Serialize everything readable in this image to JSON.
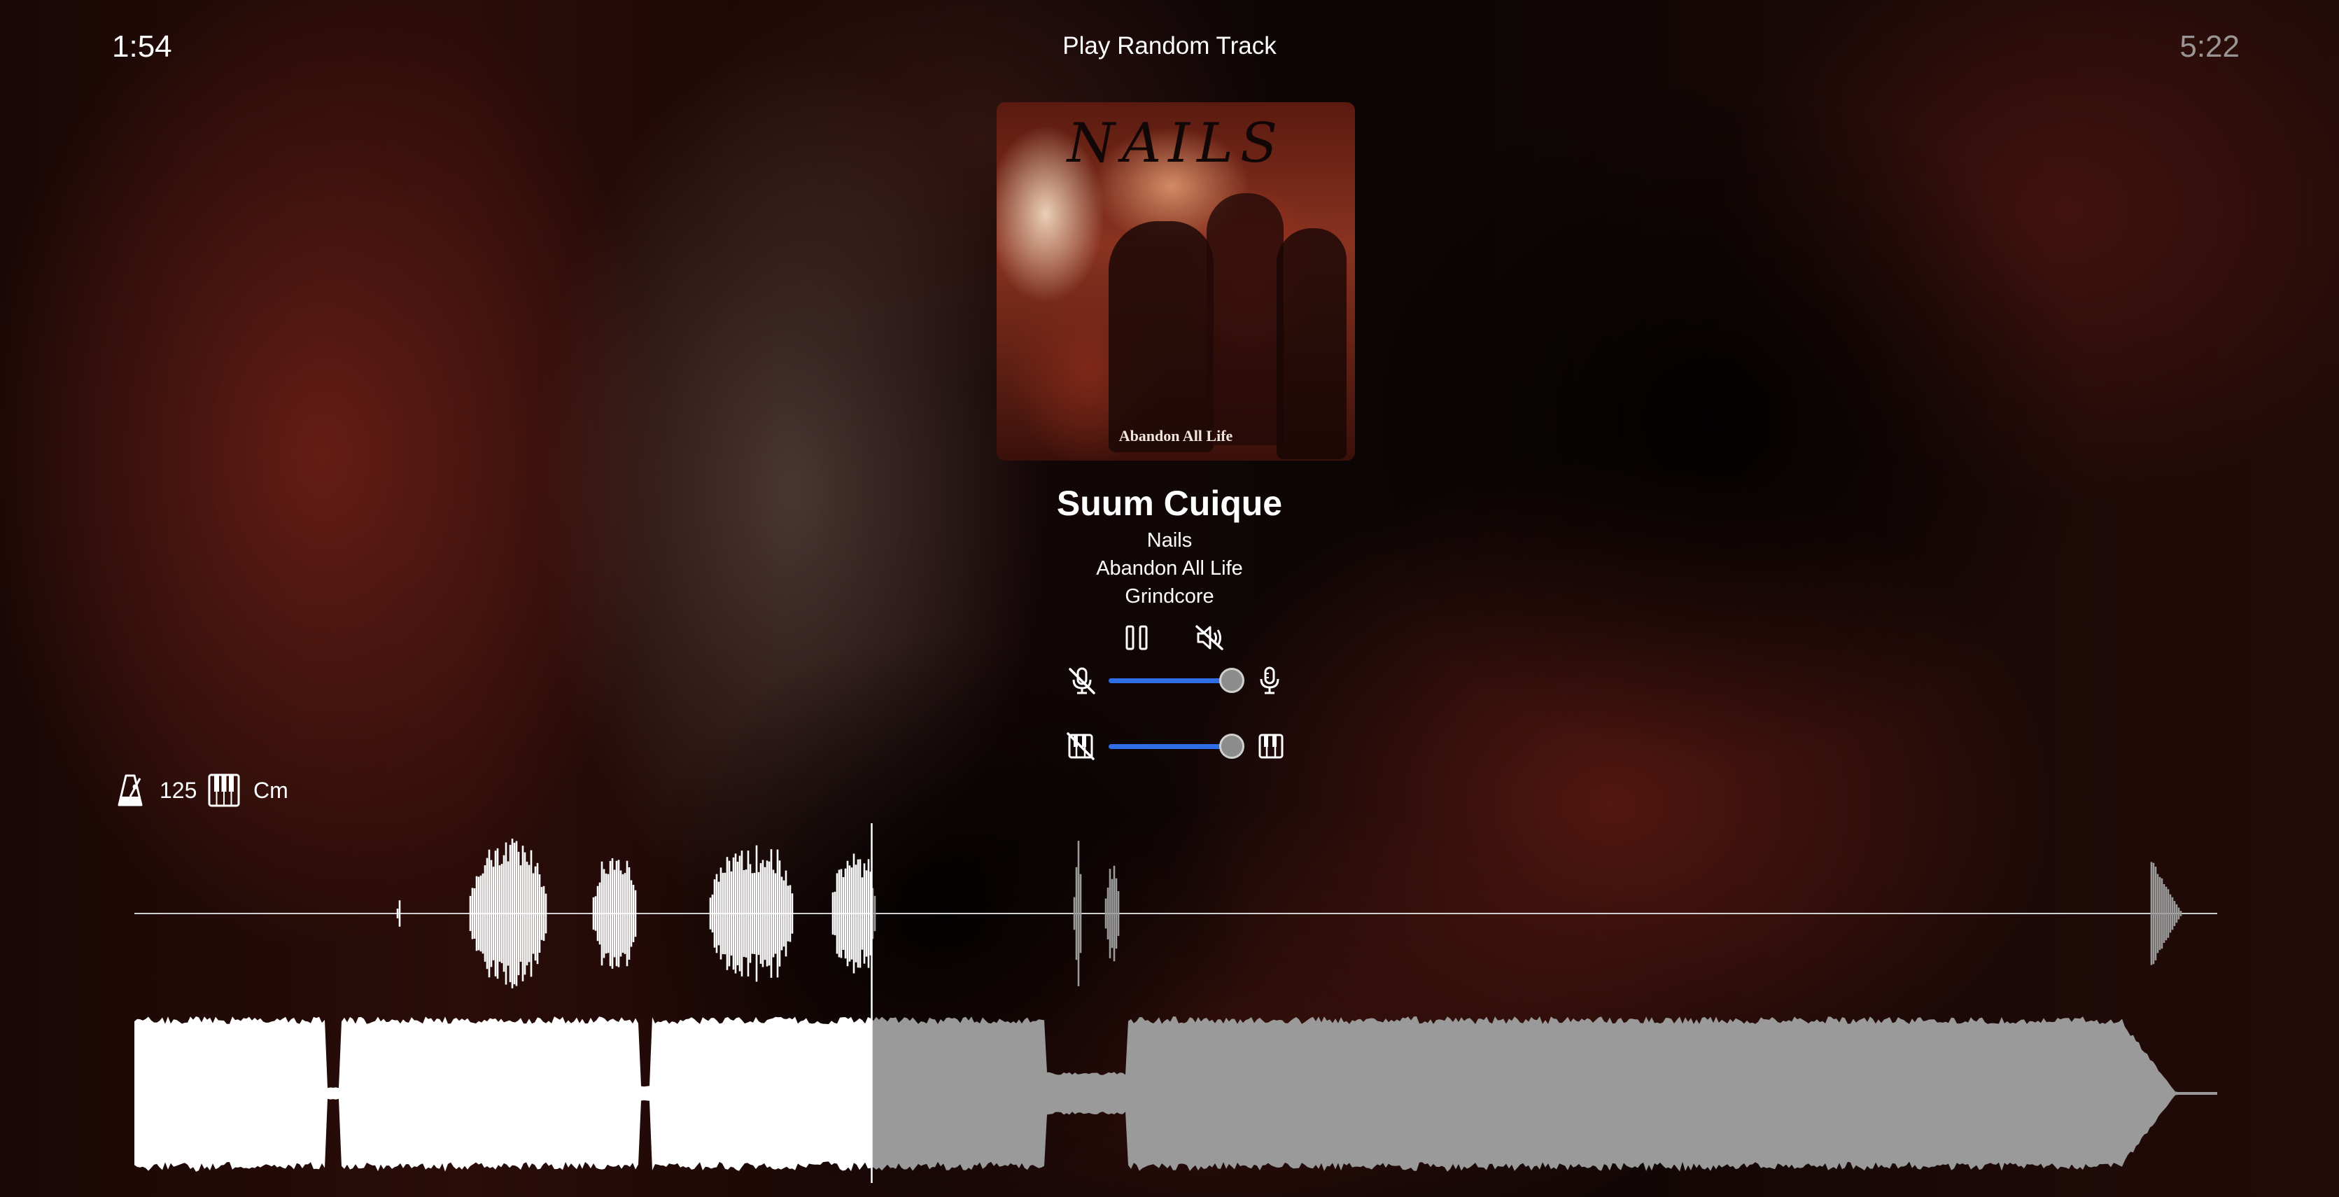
{
  "header": {
    "elapsed": "1:54",
    "title": "Play Random Track",
    "duration": "5:22"
  },
  "album_art": {
    "band_logo": "NAILS",
    "caption": "Abandon All Life"
  },
  "track": {
    "title": "Suum Cuique",
    "artist": "Nails",
    "album": "Abandon All Life",
    "genre": "Grindcore"
  },
  "controls": {
    "pause_icon": "pause-icon",
    "mute_icon": "speaker-muted-icon",
    "vocals_off_icon": "microphone-off-icon",
    "vocals_on_icon": "microphone-icon",
    "instrumental_off_icon": "piano-off-icon",
    "instrumental_on_icon": "piano-icon",
    "vocals_level": 1.0,
    "instrumental_level": 1.0,
    "accent_color": "#2f6fe6"
  },
  "analysis": {
    "metronome_icon": "metronome-icon",
    "bpm": "125",
    "key_icon": "piano-keys-icon",
    "key": "Cm"
  },
  "waveform": {
    "progress": 0.354,
    "played_color": "#ffffff",
    "unplayed_color": "#9a9a9a"
  }
}
